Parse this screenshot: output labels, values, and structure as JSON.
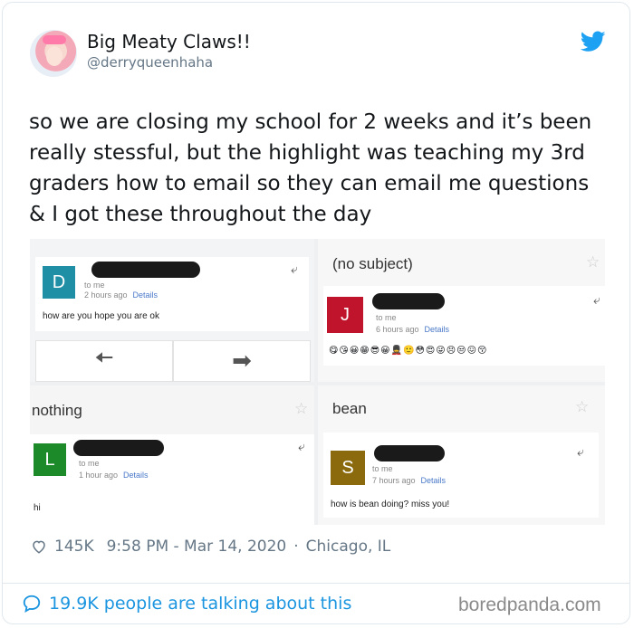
{
  "user": {
    "display_name": "Big Meaty Claws!!",
    "handle": "@derryqueenhaha"
  },
  "tweet": {
    "text": "so we are closing my school for 2 weeks and it’s been really stessful, but the highlight was teaching my 3rd graders how to email so they can email me questions & I got these throughout the day"
  },
  "emails": {
    "d": {
      "avatar_letter": "D",
      "avatar_color": "#1f8fa6",
      "to": "to me",
      "time": "2 hours ago",
      "details": "Details",
      "body": "how are you hope you are ok"
    },
    "j": {
      "subject": "(no subject)",
      "avatar_letter": "J",
      "avatar_color": "#c0142c",
      "to": "to me",
      "time": "6 hours ago",
      "details": "Details",
      "emojis": "😋😘😀😁😎😀💂🙂😳😍😜😣😒😖😚"
    },
    "l": {
      "subject": "nothing",
      "avatar_letter": "L",
      "avatar_color": "#1d8a2a",
      "to": "to me",
      "time": "1 hour ago",
      "details": "Details",
      "body": "hi"
    },
    "s": {
      "subject": "bean",
      "avatar_letter": "S",
      "avatar_color": "#8a6a0d",
      "to": "to me",
      "time": "7 hours ago",
      "details": "Details",
      "body": "how is bean doing? miss you!"
    }
  },
  "meta": {
    "likes": "145K",
    "timestamp": "9:58 PM - Mar 14, 2020",
    "separator": "·",
    "location": "Chicago, IL"
  },
  "footer": {
    "talking": "19.9K people are talking about this",
    "watermark": "boredpanda.com"
  },
  "colors": {
    "twitter_blue": "#1da1f2",
    "link_blue": "#1b95e0"
  }
}
